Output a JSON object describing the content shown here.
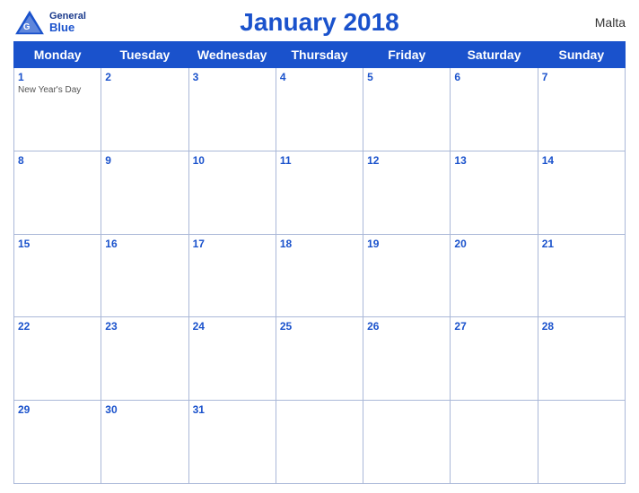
{
  "header": {
    "title": "January 2018",
    "country": "Malta",
    "logo_general": "General",
    "logo_blue": "Blue"
  },
  "days_of_week": [
    "Monday",
    "Tuesday",
    "Wednesday",
    "Thursday",
    "Friday",
    "Saturday",
    "Sunday"
  ],
  "weeks": [
    [
      {
        "num": "1",
        "holiday": "New Year's Day"
      },
      {
        "num": "2"
      },
      {
        "num": "3"
      },
      {
        "num": "4"
      },
      {
        "num": "5"
      },
      {
        "num": "6"
      },
      {
        "num": "7"
      }
    ],
    [
      {
        "num": "8"
      },
      {
        "num": "9"
      },
      {
        "num": "10"
      },
      {
        "num": "11"
      },
      {
        "num": "12"
      },
      {
        "num": "13"
      },
      {
        "num": "14"
      }
    ],
    [
      {
        "num": "15"
      },
      {
        "num": "16"
      },
      {
        "num": "17"
      },
      {
        "num": "18"
      },
      {
        "num": "19"
      },
      {
        "num": "20"
      },
      {
        "num": "21"
      }
    ],
    [
      {
        "num": "22"
      },
      {
        "num": "23"
      },
      {
        "num": "24"
      },
      {
        "num": "25"
      },
      {
        "num": "26"
      },
      {
        "num": "27"
      },
      {
        "num": "28"
      }
    ],
    [
      {
        "num": "29"
      },
      {
        "num": "30"
      },
      {
        "num": "31"
      },
      {
        "num": ""
      },
      {
        "num": ""
      },
      {
        "num": ""
      },
      {
        "num": ""
      }
    ]
  ],
  "accent_color": "#1a52cc"
}
